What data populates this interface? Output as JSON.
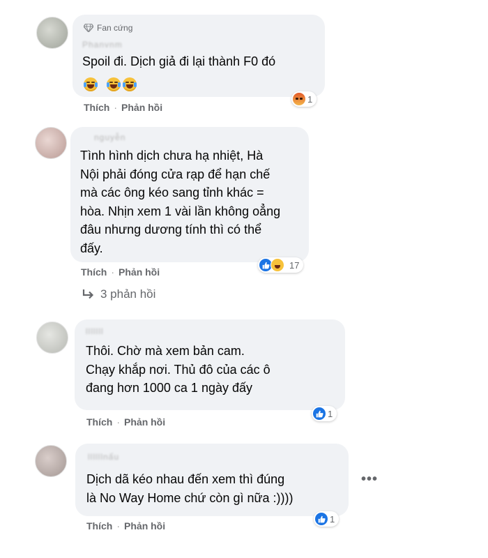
{
  "comments": [
    {
      "author": "Phanvnm",
      "badge": "Fan cứng",
      "text": "Spoil đi. Dịch giả đi lại thành F0 đó",
      "emoji_count": 3,
      "reaction_count": "1",
      "reaction_type": "angry",
      "like_label": "Thích",
      "reply_label": "Phản hồi"
    },
    {
      "author": "nguyễn",
      "text": "Tình hình dịch chưa hạ nhiệt, Hà\nNội phải đóng cửa rạp để hạn chế\nmà các ông kéo sang tỉnh khác =\nhòa. Nhịn xem 1 vài lần không oẳng\nđâu nhưng dương tính thì có thể\nđấy.",
      "reaction_count": "17",
      "reaction_type": "like-haha",
      "like_label": "Thích",
      "reply_label": "Phản hồi",
      "replies_label": "3 phản hồi"
    },
    {
      "author": "lllllll",
      "text": "Thôi. Chờ mà xem bản cam.\nChạy khắp nơi. Thủ đô của các ô\nđang hơn 1000 ca 1 ngày đấy",
      "reaction_count": "1",
      "reaction_type": "like",
      "like_label": "Thích",
      "reply_label": "Phản hồi"
    },
    {
      "author": "llllllnấu",
      "text": "Dịch dã kéo nhau đến xem thì đúng\nlà No Way Home chứ còn gì nữa :))))",
      "reaction_count": "1",
      "reaction_type": "like",
      "like_label": "Thích",
      "reply_label": "Phản hồi",
      "more_icon": "more-options-icon"
    }
  ],
  "icons": {
    "badge": "diamond-icon",
    "reply_arrow": "reply-arrow-icon",
    "like": "like-icon",
    "angry": "angry-reaction-icon",
    "haha": "haha-reaction-icon"
  },
  "colors": {
    "bubble": "#f0f2f5",
    "secondary_text": "#65676b",
    "like_blue": "#1b74e4"
  }
}
